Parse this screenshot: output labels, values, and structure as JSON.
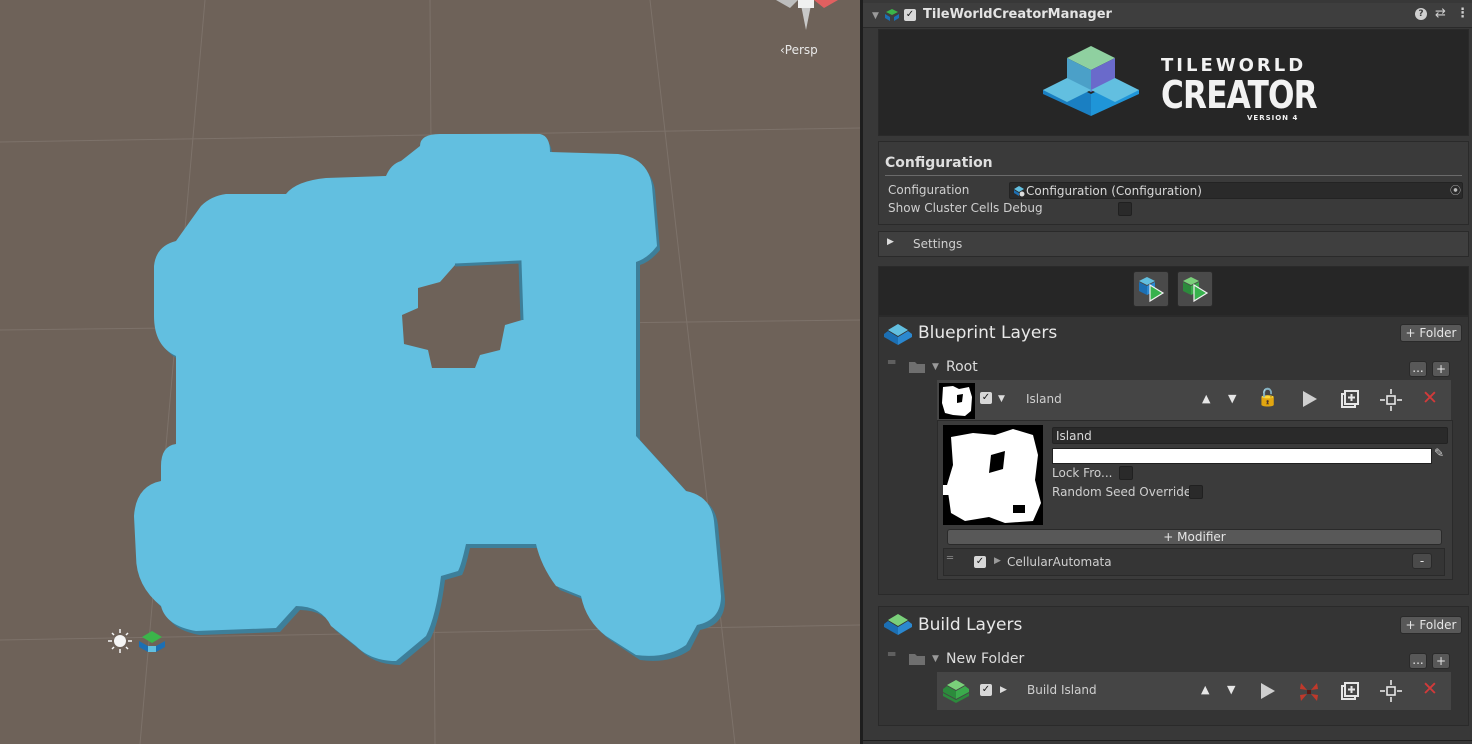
{
  "scene": {
    "camera_label": "‹Persp"
  },
  "inspector": {
    "component_title": "TileWorldCreatorManager",
    "logo": {
      "line1": "TILEWORLD",
      "line2": "CREATOR",
      "line3": "VERSION 4"
    },
    "configuration": {
      "section_title": "Configuration",
      "config_label": "Configuration",
      "config_value": "Configuration (Configuration)",
      "debug_label": "Show Cluster Cells Debug"
    },
    "settings_label": "Settings",
    "blueprint": {
      "title": "Blueprint Layers",
      "add_folder": "+ Folder",
      "folder_name": "Root",
      "folder_more": "...",
      "folder_add": "+",
      "layer_name": "Island",
      "name_field": "Island",
      "lock_label": "Lock Fro...",
      "seed_label": "Random Seed Override",
      "add_modifier": "+ Modifier",
      "modifier_name": "CellularAutomata",
      "modifier_remove": "-"
    },
    "build": {
      "title": "Build Layers",
      "add_folder": "+ Folder",
      "folder_name": "New Folder",
      "folder_more": "...",
      "folder_add": "+",
      "layer_name": "Build Island"
    },
    "colors": {
      "accent_blue": "#62bfe0",
      "remove_red": "#d23a3a",
      "play_green": "#37b24d"
    }
  }
}
